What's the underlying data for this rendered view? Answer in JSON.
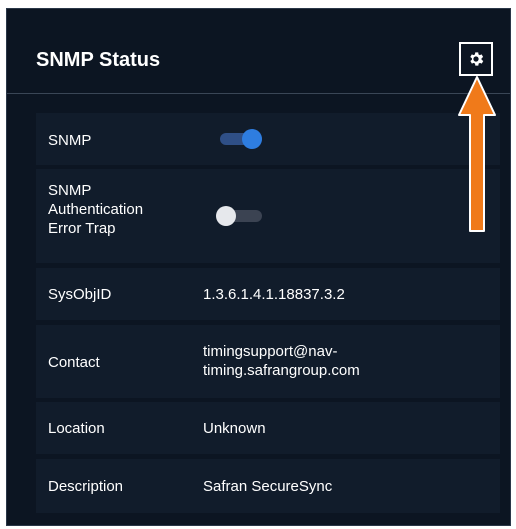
{
  "panel": {
    "title": "SNMP Status"
  },
  "rows": [
    {
      "label": "SNMP",
      "type": "toggle",
      "on": true
    },
    {
      "label_lines": [
        "SNMP",
        "Authentication",
        "Error Trap"
      ],
      "type": "toggle",
      "on": false
    },
    {
      "label": "SysObjID",
      "value": "1.3.6.1.4.1.18837.3.2"
    },
    {
      "label": "Contact",
      "value_lines": [
        "timingsupport@nav-",
        "timing.safrangroup.com"
      ]
    },
    {
      "label": "Location",
      "value": "Unknown"
    },
    {
      "label": "Description",
      "value": "Safran SecureSync"
    }
  ],
  "icons": {
    "settings": "gear-icon",
    "annotation": "arrow-up-icon"
  },
  "colors": {
    "panel_bg": "#0c1522",
    "row_bg": "#111c2b",
    "toggle_on_track": "#2f4f86",
    "toggle_on_knob": "#2e7de0",
    "toggle_off_track": "#3b4352",
    "toggle_off_knob": "#e6e8ec",
    "arrow": "#f07a1a"
  }
}
